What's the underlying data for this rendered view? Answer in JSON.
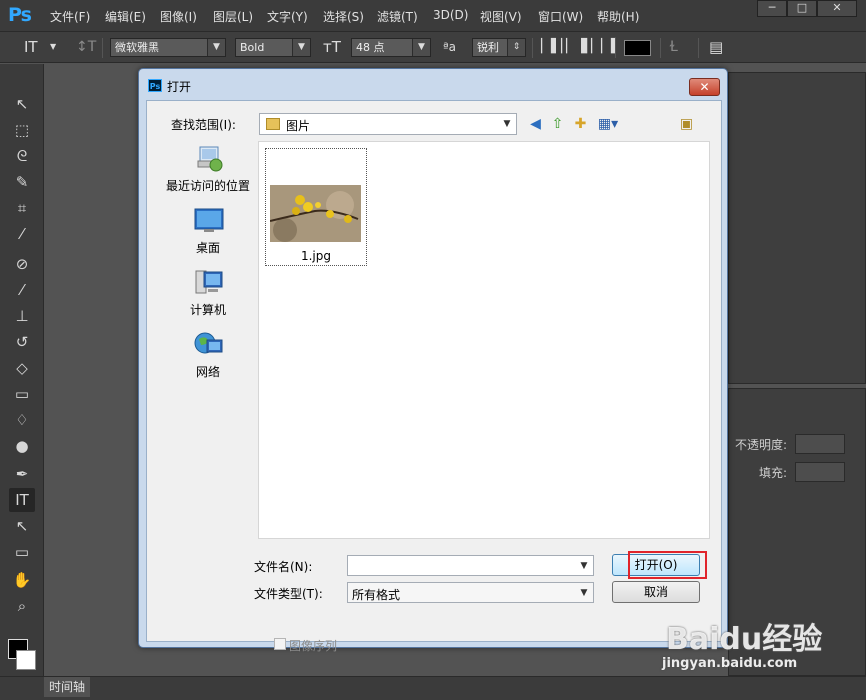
{
  "app": {
    "logo": "Ps",
    "menu": [
      "文件(F)",
      "编辑(E)",
      "图像(I)",
      "图层(L)",
      "文字(Y)",
      "选择(S)",
      "滤镜(T)",
      "3D(D)",
      "视图(V)",
      "窗口(W)",
      "帮助(H)"
    ],
    "window_controls": [
      "─",
      "□",
      "✕"
    ]
  },
  "options": {
    "font_family": "微软雅黑",
    "font_style": "Bold",
    "font_size": "48 点",
    "antialias": "锐利"
  },
  "right_panel": {
    "opacity_label": "不透明度:",
    "fill_label": "填充:"
  },
  "bottom": {
    "timeline_tab": "时间轴"
  },
  "dialog": {
    "title": "打开",
    "close_glyph": "✕",
    "look_in_label": "查找范围(I):",
    "look_in_value": "图片",
    "places": [
      "最近访问的位置",
      "桌面",
      "计算机",
      "网络"
    ],
    "file_name": "1.jpg",
    "filename_label": "文件名(N):",
    "filename_value": "",
    "filetype_label": "文件类型(T):",
    "filetype_value": "所有格式",
    "open_button": "打开(O)",
    "cancel_button": "取消",
    "image_sequence_label": "图像序列"
  },
  "watermark": {
    "brand": "Baidu经验",
    "url": "jingyan.baidu.com"
  },
  "colors": {
    "accent": "#31a8ff",
    "highlight": "#e0242b",
    "dialog_frame": "#c9d9ec"
  }
}
